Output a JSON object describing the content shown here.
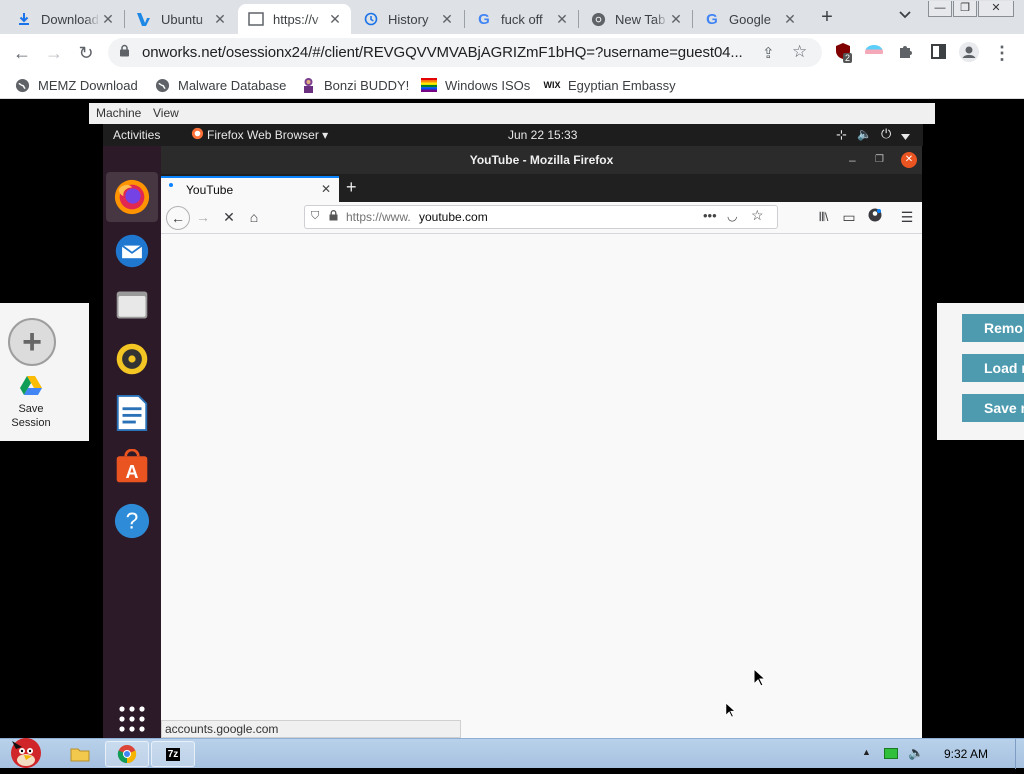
{
  "chrome": {
    "tabs": [
      {
        "title": "Downloads",
        "icon": "download-icon"
      },
      {
        "title": "Ubuntu",
        "icon": "vultr-icon"
      },
      {
        "title": "https://v",
        "icon": "page-icon",
        "active": true
      },
      {
        "title": "History",
        "icon": "history-icon"
      },
      {
        "title": "fuck off",
        "icon": "google-icon"
      },
      {
        "title": "New Tab",
        "icon": "chrome-icon"
      },
      {
        "title": "Google",
        "icon": "google-icon"
      }
    ],
    "tab_close": "✕",
    "new_tab": "+",
    "url": "onworks.net/osessionx24/#/client/REVGQVVMVABjAGRIZmF1bHQ=?username=guest04...",
    "extension_badge": "2",
    "bookmarks": [
      {
        "label": "MEMZ Download",
        "icon": "globe-icon"
      },
      {
        "label": "Malware Database",
        "icon": "globe-icon"
      },
      {
        "label": "Bonzi BUDDY!",
        "icon": "bonzi-icon"
      },
      {
        "label": "Windows ISOs",
        "icon": "windows-flag-icon"
      },
      {
        "label": "Egyptian Embassy",
        "icon": "wix-icon"
      }
    ]
  },
  "vm_menu": {
    "machine": "Machine",
    "view": "View"
  },
  "left_panel": {
    "save_line1": "Save",
    "save_line2": "Session"
  },
  "right_panel": {
    "buttons": [
      "Remo",
      "Load r",
      "Save r"
    ]
  },
  "ubuntu": {
    "activities": "Activities",
    "app_menu": "Firefox Web Browser ▾",
    "clock": "Jun 22  15:33",
    "dock_apps": [
      "firefox-icon",
      "thunderbird-icon",
      "files-icon",
      "rhythmbox-icon",
      "writer-icon",
      "software-icon",
      "help-icon",
      "app-grid-icon"
    ]
  },
  "firefox": {
    "window_title": "YouTube - Mozilla Firefox",
    "tab_title": "YouTube",
    "url_prefix": "https://www.",
    "url_domain": "youtube.com",
    "status": "accounts.google.com"
  },
  "taskbar": {
    "clock": "9:32 AM"
  },
  "colors": {
    "chrome_bg": "#dee1e6",
    "ubuntu_dock": "#2c1a28",
    "ubuntu_accent": "#e95420",
    "session_buttons": "#4e9bb0",
    "taskbar": "#b9d1ea"
  }
}
